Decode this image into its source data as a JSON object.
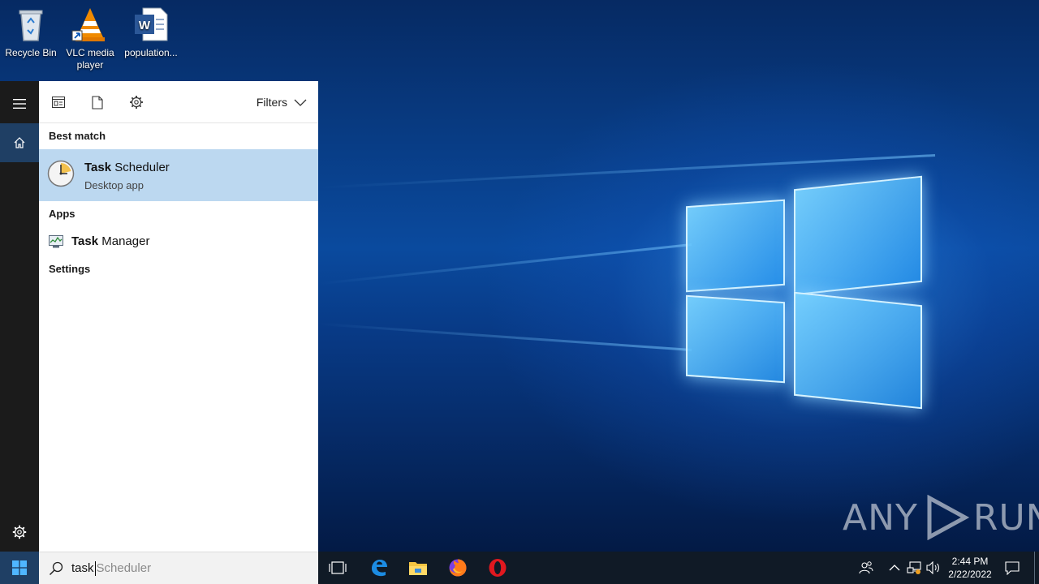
{
  "desktop": {
    "icons": [
      {
        "label": "Recycle Bin",
        "icon": "recycle-bin-icon"
      },
      {
        "label": "VLC media player",
        "icon": "vlc-icon"
      },
      {
        "label": "population...",
        "icon": "word-document-icon"
      }
    ],
    "watermark": {
      "left": "ANY",
      "right": "RUN"
    }
  },
  "start_menu": {
    "rail": [
      {
        "icon": "hamburger-menu-icon"
      },
      {
        "icon": "home-icon",
        "selected": true
      },
      {
        "icon": "gear-icon"
      }
    ],
    "toolbar": {
      "tools": [
        "apps-filter-icon",
        "documents-filter-icon",
        "settings-filter-icon"
      ],
      "filters_label": "Filters"
    },
    "sections": {
      "best_match": "Best match",
      "apps": "Apps",
      "settings": "Settings"
    },
    "best_match_item": {
      "title_bold": "Task",
      "title_rest": " Scheduler",
      "subtitle": "Desktop app",
      "icon": "clock-icon"
    },
    "apps": [
      {
        "title_bold": "Task",
        "title_rest": " Manager",
        "icon": "task-manager-icon"
      }
    ]
  },
  "taskbar": {
    "search": {
      "typed": "task",
      "suggestion": "Scheduler"
    },
    "apps": [
      "task-view-icon",
      "edge-icon",
      "file-explorer-icon",
      "firefox-icon",
      "opera-icon"
    ],
    "clock": {
      "time": "2:44 PM",
      "date": "2/22/2022"
    },
    "accent": "#0078d7",
    "selection_color": "#bcd8f0"
  }
}
